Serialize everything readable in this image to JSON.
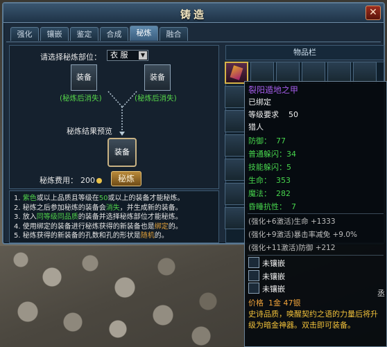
{
  "window": {
    "title": "铸造",
    "close_icon": "close-icon"
  },
  "tabs": [
    "强化",
    "镶嵌",
    "鉴定",
    "合成",
    "秘炼",
    "融合"
  ],
  "active_tab": "秘炼",
  "refine": {
    "part_label": "请选择秘炼部位：",
    "part_value": "衣  服",
    "slot_left": "装备",
    "slot_right": "装备",
    "vanish_note_left": "(秘炼后消失)",
    "vanish_note_right": "(秘炼后消失)",
    "preview_label": "秘炼结果预览",
    "result_slot": "装备",
    "fee_label": "秘炼费用：",
    "fee_value": "200",
    "refine_button": "秘炼"
  },
  "rules": [
    {
      "n": "1.",
      "a": "紫色",
      "b": "或以上品质且等级在",
      "c": "50",
      "d": "或以上的装备才能秘炼。"
    },
    {
      "n": "2.",
      "a": "秘炼之后参加秘炼的装备会",
      "b": "消失",
      "c": "，并生成新的装备。"
    },
    {
      "n": "3.",
      "a": "放入",
      "b": "同等级同品质",
      "c": "的装备并选择秘炼部位才能秘炼。"
    },
    {
      "n": "4.",
      "a": "使用绑定的装备进行秘炼获得的新装备也是",
      "b": "绑定",
      "c": "的。"
    },
    {
      "n": "5.",
      "a": "秘炼获得的新装备的孔数和孔的形状是",
      "b": "随机",
      "c": "的。"
    }
  ],
  "inventory": {
    "header": "物品栏"
  },
  "tooltip": {
    "name": "裂阳遁地之甲",
    "bound": "已绑定",
    "level_label": "等级要求",
    "level_value": "50",
    "class": "猎人",
    "stats": [
      {
        "label": "防御：",
        "value": "77"
      },
      {
        "label": "普通躲闪：",
        "value": "34"
      },
      {
        "label": "技能躲闪：",
        "value": "5"
      },
      {
        "label": "生命：",
        "value": "353"
      },
      {
        "label": "魔法：",
        "value": "282"
      },
      {
        "label": "昏睡抗性：",
        "value": "7"
      }
    ],
    "extras": [
      "(强化+6激活)生命 +1333",
      "(强化+9激活)暴击率减免 +9.0%",
      "(强化+11激活)防御 +212"
    ],
    "sockets": [
      "未镶嵌",
      "未镶嵌",
      "未镶嵌"
    ],
    "price_label": "价格",
    "price_value": "1金 47银",
    "description": "史诗品质，唤醒契约之语的力量后将升级为暗金神器。双击即可装备。"
  },
  "side_fragment": "丞",
  "colors": {
    "accent_green": "#4fd04a",
    "accent_orange": "#e3a23a",
    "epic_purple": "#a35ce8",
    "gold_text": "#f0c03a"
  }
}
